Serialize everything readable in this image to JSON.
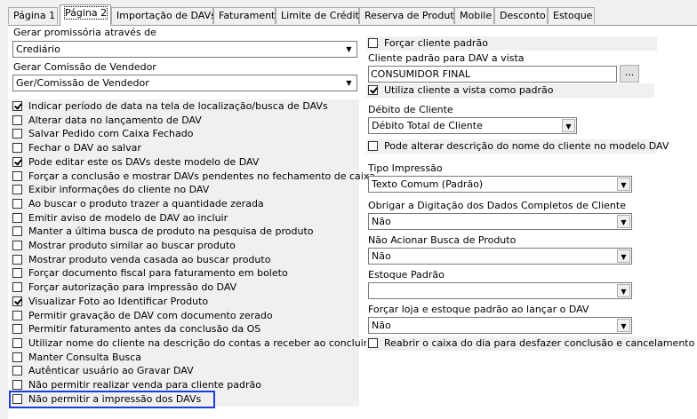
{
  "tabs": [
    {
      "label": "Página 1",
      "active": false
    },
    {
      "label": "Página 2",
      "active": true
    },
    {
      "label": "Importação de DAVs",
      "active": false
    },
    {
      "label": "Faturamento",
      "active": false
    },
    {
      "label": "Limite de Crédito",
      "active": false
    },
    {
      "label": "Reserva de Produto",
      "active": false
    },
    {
      "label": "Mobile",
      "active": false
    },
    {
      "label": "Desconto",
      "active": false
    },
    {
      "label": "Estoque",
      "active": false
    }
  ],
  "left": {
    "promissoria_label": "Gerar promissória através de",
    "promissoria_value": "Crediário",
    "comissao_label": "Gerar Comissão de Vendedor",
    "comissao_value": "Ger/Comissão de Vendedor",
    "options": [
      {
        "label": "Indicar período de data na tela de localização/busca de DAVs",
        "checked": true
      },
      {
        "label": "Alterar data no lançamento de DAV",
        "checked": false
      },
      {
        "label": "Salvar Pedido com Caixa Fechado",
        "checked": false
      },
      {
        "label": "Fechar o DAV ao salvar",
        "checked": false
      },
      {
        "label": "Pode editar este os DAVs deste modelo de DAV",
        "checked": true
      },
      {
        "label": "Forçar a conclusão e mostrar DAVs pendentes no fechamento de caixa",
        "checked": false
      },
      {
        "label": "Exibir informações do cliente no DAV",
        "checked": false
      },
      {
        "label": "Ao buscar o produto trazer a quantidade zerada",
        "checked": false
      },
      {
        "label": "Emitir aviso de modelo de DAV ao incluir",
        "checked": false
      },
      {
        "label": "Manter a última busca de produto na pesquisa de produto",
        "checked": false
      },
      {
        "label": "Mostrar produto similar ao buscar produto",
        "checked": false
      },
      {
        "label": "Mostrar produto venda casada ao buscar produto",
        "checked": false
      },
      {
        "label": "Forçar documento fiscal para faturamento em boleto",
        "checked": false
      },
      {
        "label": "Forçar autorização para impressão do DAV",
        "checked": false
      },
      {
        "label": "Visualizar Foto ao Identificar Produto",
        "checked": true
      },
      {
        "label": "Permitir gravação de DAV com documento zerado",
        "checked": false
      },
      {
        "label": "Permitir faturamento antes da conclusão da OS",
        "checked": false
      },
      {
        "label": "Utilizar nome do cliente na descrição do contas a receber ao concluir o Dav",
        "checked": false
      },
      {
        "label": "Manter Consulta Busca",
        "checked": false
      },
      {
        "label": "Autênticar usuário ao Gravar DAV",
        "checked": false
      },
      {
        "label": "Não permitir realizar venda para cliente padrão",
        "checked": false
      },
      {
        "label": "Não permitir a impressão dos DAVs",
        "checked": false
      }
    ]
  },
  "right": {
    "forcar_cliente": {
      "label": "Forçar cliente padrão",
      "checked": false
    },
    "cliente_avista_label": "Cliente padrão para DAV a vista",
    "cliente_avista_value": "CONSUMIDOR FINAL",
    "browse_button": "...",
    "utiliza_avista": {
      "label": "Utiliza cliente a vista como padrão",
      "checked": true
    },
    "debito_label": "Débito de Cliente",
    "debito_value": "Débito Total de Cliente",
    "alterar_descricao": {
      "label": "Pode alterar descrição do nome do cliente no modelo DAV",
      "checked": false
    },
    "tipo_impressao_label": "Tipo Impressão",
    "tipo_impressao_value": "Texto Comum (Padrão)",
    "obrigar_label": "Obrigar a Digitação dos Dados Completos de Cliente",
    "obrigar_value": "Não",
    "nao_acionar_label": "Não Acionar Busca de Produto",
    "nao_acionar_value": "Não",
    "estoque_label": "Estoque Padrão",
    "estoque_value": "",
    "forcar_loja_label": "Forçar loja e estoque padrão ao lançar o DAV",
    "forcar_loja_value": "Não",
    "reabrir": {
      "label": "Reabrir o caixa do dia para desfazer conclusão e cancelamento",
      "checked": false
    }
  }
}
